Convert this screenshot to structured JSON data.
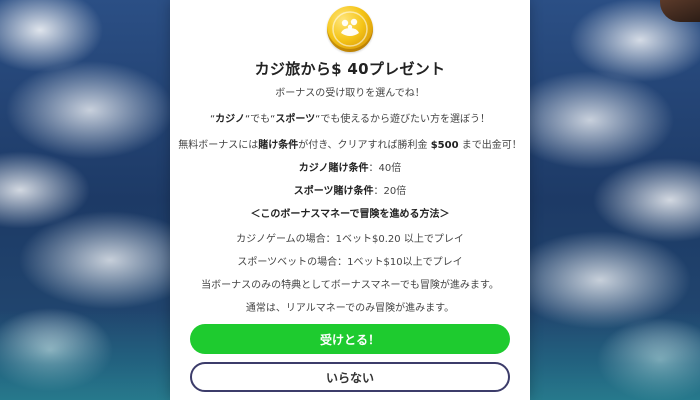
{
  "modal": {
    "icon": "gold-coin-icon",
    "title": "カジ旅から$ 40プレゼント",
    "subtitle": "ボーナスの受け取りを選んでね！",
    "line1": {
      "q1": "“",
      "casino": "カジノ",
      "mid1": "“でも“",
      "sports": "スポーツ",
      "rest": "“でも使えるから遊びたい方を選ぼう！"
    },
    "line2": {
      "pre": "無料ボーナスには",
      "wager": "賭け条件",
      "mid": "が付き、クリアすれば勝利金 ",
      "amount": "$500",
      "post": " まで出金可！"
    },
    "casino_wager": {
      "label": "カジノ賭け条件",
      "value": "：40倍"
    },
    "sports_wager": {
      "label": "スポーツ賭け条件",
      "value": "：20倍"
    },
    "how_to_heading": "＜このボーナスマネーで冒険を進める方法＞",
    "casino_game_rule": "カジノゲームの場合：1ベット$0.20 以上でプレイ",
    "sports_bet_rule": "スポーツベットの場合：1ベット$10以上でプレイ",
    "bonus_only_note": "当ボーナスのみの特典としてボーナスマネーでも冒険が進みます。",
    "normal_note": "通常は、リアルマネーでのみ冒険が進みます。",
    "accept_label": "受けとる！",
    "decline_label": "いらない"
  },
  "colors": {
    "accept_button": "#1ecb2f",
    "decline_border": "#3c3c6a",
    "coin": "#f5c518"
  }
}
